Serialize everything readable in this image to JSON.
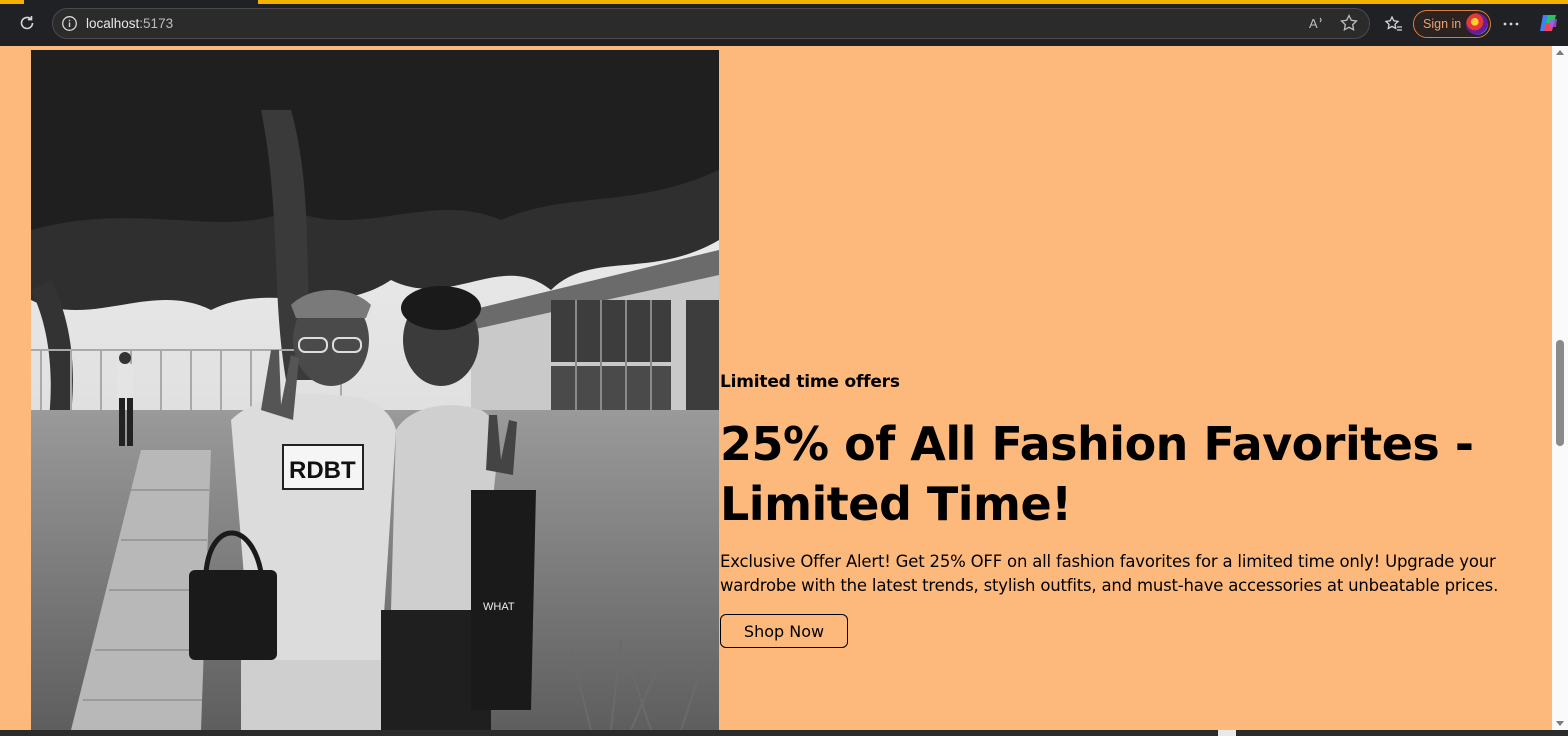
{
  "browser": {
    "url_host": "localhost",
    "url_port": ":5173",
    "signin_label": "Sign in"
  },
  "hero": {
    "kicker": "Limited time offers",
    "headline": "25% of All Fashion Favorites - Limited Time!",
    "description": "Exclusive Offer Alert! Get 25% OFF on all fashion favorites for a limited time only! Upgrade your wardrobe with the latest trends, stylish outfits, and must-have accessories at unbeatable prices.",
    "cta_label": "Shop Now",
    "photo_alt": "Two women smiling outdoors",
    "shirt_text": "RDBT"
  },
  "colors": {
    "page_background": "#fdb97c",
    "chrome_background": "#202124",
    "loading_bar": "#f5b301",
    "signin_accent": "#e07a3a"
  },
  "icons": [
    "reload-icon",
    "info-icon",
    "read-aloud-icon",
    "favorite-star-icon",
    "favorites-icon",
    "more-icon",
    "copilot-icon"
  ]
}
